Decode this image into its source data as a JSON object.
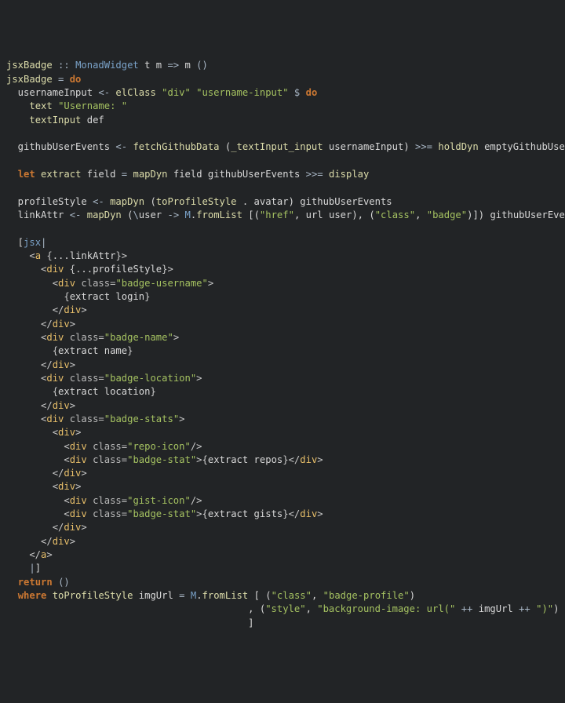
{
  "lines": [
    [
      [
        "fn",
        "jsxBadge"
      ],
      [
        "op",
        " :: "
      ],
      [
        "type",
        "MonadWidget"
      ],
      [
        "ident",
        " t m "
      ],
      [
        "op",
        "=>"
      ],
      [
        "ident",
        " m "
      ],
      [
        "op",
        "()"
      ]
    ],
    [
      [
        "fn",
        "jsxBadge"
      ],
      [
        "op",
        " = "
      ],
      [
        "kw",
        "do"
      ]
    ],
    [
      [
        "ident",
        "  usernameInput "
      ],
      [
        "op",
        "<- "
      ],
      [
        "fn",
        "elClass"
      ],
      [
        "ident",
        " "
      ],
      [
        "str",
        "\"div\""
      ],
      [
        "ident",
        " "
      ],
      [
        "str",
        "\"username-input\""
      ],
      [
        "ident",
        " "
      ],
      [
        "op",
        "$"
      ],
      [
        "ident",
        " "
      ],
      [
        "kw",
        "do"
      ]
    ],
    [
      [
        "ident",
        "    "
      ],
      [
        "fn",
        "text"
      ],
      [
        "ident",
        " "
      ],
      [
        "str",
        "\"Username: \""
      ]
    ],
    [
      [
        "ident",
        "    "
      ],
      [
        "fn",
        "textInput"
      ],
      [
        "ident",
        " def"
      ]
    ],
    [
      [
        "ident",
        ""
      ]
    ],
    [
      [
        "ident",
        "  githubUserEvents "
      ],
      [
        "op",
        "<- "
      ],
      [
        "fn",
        "fetchGithubData"
      ],
      [
        "ident",
        " ("
      ],
      [
        "fn",
        "_textInput_input"
      ],
      [
        "ident",
        " usernameInput) "
      ],
      [
        "op",
        ">>= "
      ],
      [
        "fn",
        "holdDyn"
      ],
      [
        "ident",
        " emptyGithubUser"
      ]
    ],
    [
      [
        "ident",
        ""
      ]
    ],
    [
      [
        "ident",
        "  "
      ],
      [
        "kw",
        "let"
      ],
      [
        "ident",
        " "
      ],
      [
        "fn",
        "extract"
      ],
      [
        "ident",
        " field "
      ],
      [
        "op",
        "="
      ],
      [
        "ident",
        " "
      ],
      [
        "fn",
        "mapDyn"
      ],
      [
        "ident",
        " field githubUserEvents "
      ],
      [
        "op",
        ">>= "
      ],
      [
        "fn",
        "display"
      ]
    ],
    [
      [
        "ident",
        ""
      ]
    ],
    [
      [
        "ident",
        "  profileStyle "
      ],
      [
        "op",
        "<- "
      ],
      [
        "fn",
        "mapDyn"
      ],
      [
        "ident",
        " ("
      ],
      [
        "fn",
        "toProfileStyle"
      ],
      [
        "ident",
        " . avatar) githubUserEvents"
      ]
    ],
    [
      [
        "ident",
        "  linkAttr "
      ],
      [
        "op",
        "<- "
      ],
      [
        "fn",
        "mapDyn"
      ],
      [
        "ident",
        " ("
      ],
      [
        "op",
        "\\"
      ],
      [
        "ident",
        "user "
      ],
      [
        "op",
        "->"
      ],
      [
        "ident",
        " "
      ],
      [
        "type",
        "M"
      ],
      [
        "ident",
        "."
      ],
      [
        "fn",
        "fromList"
      ],
      [
        "ident",
        " [("
      ],
      [
        "str",
        "\"href\""
      ],
      [
        "ident",
        ", url user), ("
      ],
      [
        "str",
        "\"class\""
      ],
      [
        "ident",
        ", "
      ],
      [
        "str",
        "\"badge\""
      ],
      [
        "ident",
        ")]) githubUserEvents"
      ]
    ],
    [
      [
        "ident",
        ""
      ]
    ],
    [
      [
        "ident",
        "  ["
      ],
      [
        "type",
        "jsx"
      ],
      [
        "op",
        "|"
      ]
    ],
    [
      [
        "brak",
        "    <"
      ],
      [
        "tag",
        "a"
      ],
      [
        "brak",
        " {"
      ],
      [
        "ident",
        "...linkAttr"
      ],
      [
        "brak",
        "}>"
      ]
    ],
    [
      [
        "brak",
        "      <"
      ],
      [
        "tag",
        "div"
      ],
      [
        "brak",
        " {"
      ],
      [
        "ident",
        "...profileStyle"
      ],
      [
        "brak",
        "}>"
      ]
    ],
    [
      [
        "brak",
        "        <"
      ],
      [
        "tag",
        "div"
      ],
      [
        "attr",
        " class="
      ],
      [
        "str",
        "\"badge-username\""
      ],
      [
        "brak",
        ">"
      ]
    ],
    [
      [
        "brak",
        "          {"
      ],
      [
        "ident",
        "extract login"
      ],
      [
        "brak",
        "}"
      ]
    ],
    [
      [
        "brak",
        "        </"
      ],
      [
        "tag",
        "div"
      ],
      [
        "brak",
        ">"
      ]
    ],
    [
      [
        "brak",
        "      </"
      ],
      [
        "tag",
        "div"
      ],
      [
        "brak",
        ">"
      ]
    ],
    [
      [
        "brak",
        "      <"
      ],
      [
        "tag",
        "div"
      ],
      [
        "attr",
        " class="
      ],
      [
        "str",
        "\"badge-name\""
      ],
      [
        "brak",
        ">"
      ]
    ],
    [
      [
        "brak",
        "        {"
      ],
      [
        "ident",
        "extract name"
      ],
      [
        "brak",
        "}"
      ]
    ],
    [
      [
        "brak",
        "      </"
      ],
      [
        "tag",
        "div"
      ],
      [
        "brak",
        ">"
      ]
    ],
    [
      [
        "brak",
        "      <"
      ],
      [
        "tag",
        "div"
      ],
      [
        "attr",
        " class="
      ],
      [
        "str",
        "\"badge-location\""
      ],
      [
        "brak",
        ">"
      ]
    ],
    [
      [
        "brak",
        "        {"
      ],
      [
        "ident",
        "extract location"
      ],
      [
        "brak",
        "}"
      ]
    ],
    [
      [
        "brak",
        "      </"
      ],
      [
        "tag",
        "div"
      ],
      [
        "brak",
        ">"
      ]
    ],
    [
      [
        "brak",
        "      <"
      ],
      [
        "tag",
        "div"
      ],
      [
        "attr",
        " class="
      ],
      [
        "str",
        "\"badge-stats\""
      ],
      [
        "brak",
        ">"
      ]
    ],
    [
      [
        "brak",
        "        <"
      ],
      [
        "tag",
        "div"
      ],
      [
        "brak",
        ">"
      ]
    ],
    [
      [
        "brak",
        "          <"
      ],
      [
        "tag",
        "div"
      ],
      [
        "attr",
        " class="
      ],
      [
        "str",
        "\"repo-icon\""
      ],
      [
        "brak",
        "/>"
      ]
    ],
    [
      [
        "brak",
        "          <"
      ],
      [
        "tag",
        "div"
      ],
      [
        "attr",
        " class="
      ],
      [
        "str",
        "\"badge-stat\""
      ],
      [
        "brak",
        ">"
      ],
      [
        "brak",
        "{"
      ],
      [
        "ident",
        "extract repos"
      ],
      [
        "brak",
        "}"
      ],
      [
        "brak",
        "</"
      ],
      [
        "tag",
        "div"
      ],
      [
        "brak",
        ">"
      ]
    ],
    [
      [
        "brak",
        "        </"
      ],
      [
        "tag",
        "div"
      ],
      [
        "brak",
        ">"
      ]
    ],
    [
      [
        "brak",
        "        <"
      ],
      [
        "tag",
        "div"
      ],
      [
        "brak",
        ">"
      ]
    ],
    [
      [
        "brak",
        "          <"
      ],
      [
        "tag",
        "div"
      ],
      [
        "attr",
        " class="
      ],
      [
        "str",
        "\"gist-icon\""
      ],
      [
        "brak",
        "/>"
      ]
    ],
    [
      [
        "brak",
        "          <"
      ],
      [
        "tag",
        "div"
      ],
      [
        "attr",
        " class="
      ],
      [
        "str",
        "\"badge-stat\""
      ],
      [
        "brak",
        ">"
      ],
      [
        "brak",
        "{"
      ],
      [
        "ident",
        "extract gists"
      ],
      [
        "brak",
        "}"
      ],
      [
        "brak",
        "</"
      ],
      [
        "tag",
        "div"
      ],
      [
        "brak",
        ">"
      ]
    ],
    [
      [
        "brak",
        "        </"
      ],
      [
        "tag",
        "div"
      ],
      [
        "brak",
        ">"
      ]
    ],
    [
      [
        "brak",
        "      </"
      ],
      [
        "tag",
        "div"
      ],
      [
        "brak",
        ">"
      ]
    ],
    [
      [
        "brak",
        "    </"
      ],
      [
        "tag",
        "a"
      ],
      [
        "brak",
        ">"
      ]
    ],
    [
      [
        "ident",
        "    "
      ],
      [
        "op",
        "|"
      ],
      [
        "ident",
        "]"
      ]
    ],
    [
      [
        "ident",
        "  "
      ],
      [
        "kw",
        "return"
      ],
      [
        "ident",
        " "
      ],
      [
        "op",
        "()"
      ]
    ],
    [
      [
        "ident",
        "  "
      ],
      [
        "kw",
        "where"
      ],
      [
        "ident",
        " "
      ],
      [
        "fn",
        "toProfileStyle"
      ],
      [
        "ident",
        " imgUrl "
      ],
      [
        "op",
        "="
      ],
      [
        "ident",
        " "
      ],
      [
        "type",
        "M"
      ],
      [
        "ident",
        "."
      ],
      [
        "fn",
        "fromList"
      ],
      [
        "ident",
        " [ ("
      ],
      [
        "str",
        "\"class\""
      ],
      [
        "ident",
        ", "
      ],
      [
        "str",
        "\"badge-profile\""
      ],
      [
        "ident",
        ")"
      ]
    ],
    [
      [
        "ident",
        "                                          , ("
      ],
      [
        "str",
        "\"style\""
      ],
      [
        "ident",
        ", "
      ],
      [
        "str",
        "\"background-image: url(\""
      ],
      [
        "ident",
        " "
      ],
      [
        "op",
        "++"
      ],
      [
        "ident",
        " imgUrl "
      ],
      [
        "op",
        "++"
      ],
      [
        "ident",
        " "
      ],
      [
        "str",
        "\")\""
      ],
      [
        "ident",
        ")"
      ]
    ],
    [
      [
        "ident",
        "                                          ]"
      ]
    ]
  ]
}
